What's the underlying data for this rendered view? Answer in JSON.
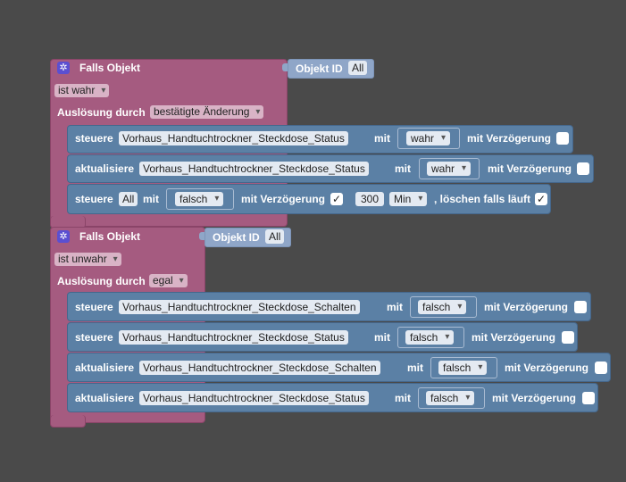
{
  "block1": {
    "title": "Falls Objekt",
    "object_label": "Objekt ID",
    "object_value": "All",
    "condition": "ist wahr",
    "trigger_label": "Auslösung durch",
    "trigger_value": "bestätigte Änderung",
    "rows": [
      {
        "verb": "steuere",
        "object": "Vorhaus_Handtuchtrockner_Steckdose_Status",
        "mit": "mit",
        "value": "wahr",
        "delay_label": "mit Verzögerung"
      },
      {
        "verb": "aktualisiere",
        "object": "Vorhaus_Handtuchtrockner_Steckdose_Status",
        "mit": "mit",
        "value": "wahr",
        "delay_label": "mit Verzögerung"
      },
      {
        "verb": "steuere",
        "object": "All",
        "mit": "mit",
        "value": "falsch",
        "delay_label": "mit Verzögerung",
        "delay_check": "✓",
        "delay_value": "300",
        "unit": "Min",
        "clear_label": ", löschen falls läuft",
        "clear_check": "✓"
      }
    ]
  },
  "block2": {
    "title": "Falls Objekt",
    "object_label": "Objekt ID",
    "object_value": "All",
    "condition": "ist unwahr",
    "trigger_label": "Auslösung durch",
    "trigger_value": "egal",
    "rows": [
      {
        "verb": "steuere",
        "object": "Vorhaus_Handtuchtrockner_Steckdose_Schalten",
        "mit": "mit",
        "value": "falsch",
        "delay_label": "mit Verzögerung"
      },
      {
        "verb": "steuere",
        "object": "Vorhaus_Handtuchtrockner_Steckdose_Status",
        "mit": "mit",
        "value": "falsch",
        "delay_label": "mit Verzögerung"
      },
      {
        "verb": "aktualisiere",
        "object": "Vorhaus_Handtuchtrockner_Steckdose_Schalten",
        "mit": "mit",
        "value": "falsch",
        "delay_label": "mit Verzögerung"
      },
      {
        "verb": "aktualisiere",
        "object": "Vorhaus_Handtuchtrockner_Steckdose_Status",
        "mit": "mit",
        "value": "falsch",
        "delay_label": "mit Verzögerung"
      }
    ]
  },
  "icons": {
    "gear": "gear-icon",
    "dropdown": "chevron-down-icon"
  },
  "colors": {
    "background": "#4a4a4a",
    "trigger_block": "#a55b80",
    "command_block": "#5b80a5",
    "object_id_block": "#8fa6c8",
    "gear": "#5b4fd1"
  }
}
